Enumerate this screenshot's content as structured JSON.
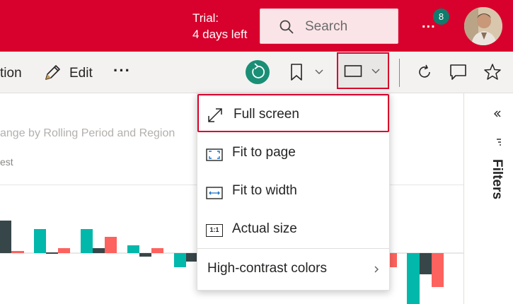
{
  "header": {
    "trial_line1": "Trial:",
    "trial_line2": "4 days left",
    "search_placeholder": "Search",
    "more_label": "...",
    "notification_count": "8",
    "accent_color": "#d8002c"
  },
  "toolbar": {
    "partial_label": "tion",
    "edit_label": "Edit",
    "more_label": "···",
    "icons": [
      "pencil-icon",
      "reset-icon",
      "bookmark-icon",
      "view-icon",
      "refresh-icon",
      "comment-icon",
      "star-icon"
    ]
  },
  "report": {
    "title_partial": "ange by Rolling Period and Region",
    "subtitle_partial": "est"
  },
  "filters": {
    "label": "Filters"
  },
  "view_menu": {
    "items": [
      {
        "label": "Full screen",
        "icon": "full-screen-icon",
        "selected": true
      },
      {
        "label": "Fit to page",
        "icon": "fit-to-page-icon",
        "selected": false
      },
      {
        "label": "Fit to width",
        "icon": "fit-to-width-icon",
        "selected": false
      },
      {
        "label": "Actual size",
        "icon": "actual-size-icon",
        "selected": false
      },
      {
        "label": "High-contrast colors",
        "icon": "chevron-right-icon",
        "selected": false
      }
    ],
    "actual_size_glyph": "1:1"
  }
}
